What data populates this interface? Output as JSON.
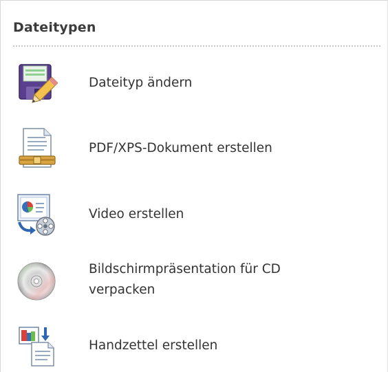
{
  "section": {
    "title": "Dateitypen"
  },
  "items": [
    {
      "label": "Dateityp ändern",
      "icon": "floppy-disk-pencil-icon"
    },
    {
      "label": "PDF/XPS-Dokument erstellen",
      "icon": "pdf-document-icon"
    },
    {
      "label": "Video erstellen",
      "icon": "video-presentation-icon"
    },
    {
      "label": "Bildschirmpräsentation für CD verpacken",
      "icon": "cd-disc-icon"
    },
    {
      "label": "Handzettel erstellen",
      "icon": "handout-icon"
    }
  ]
}
